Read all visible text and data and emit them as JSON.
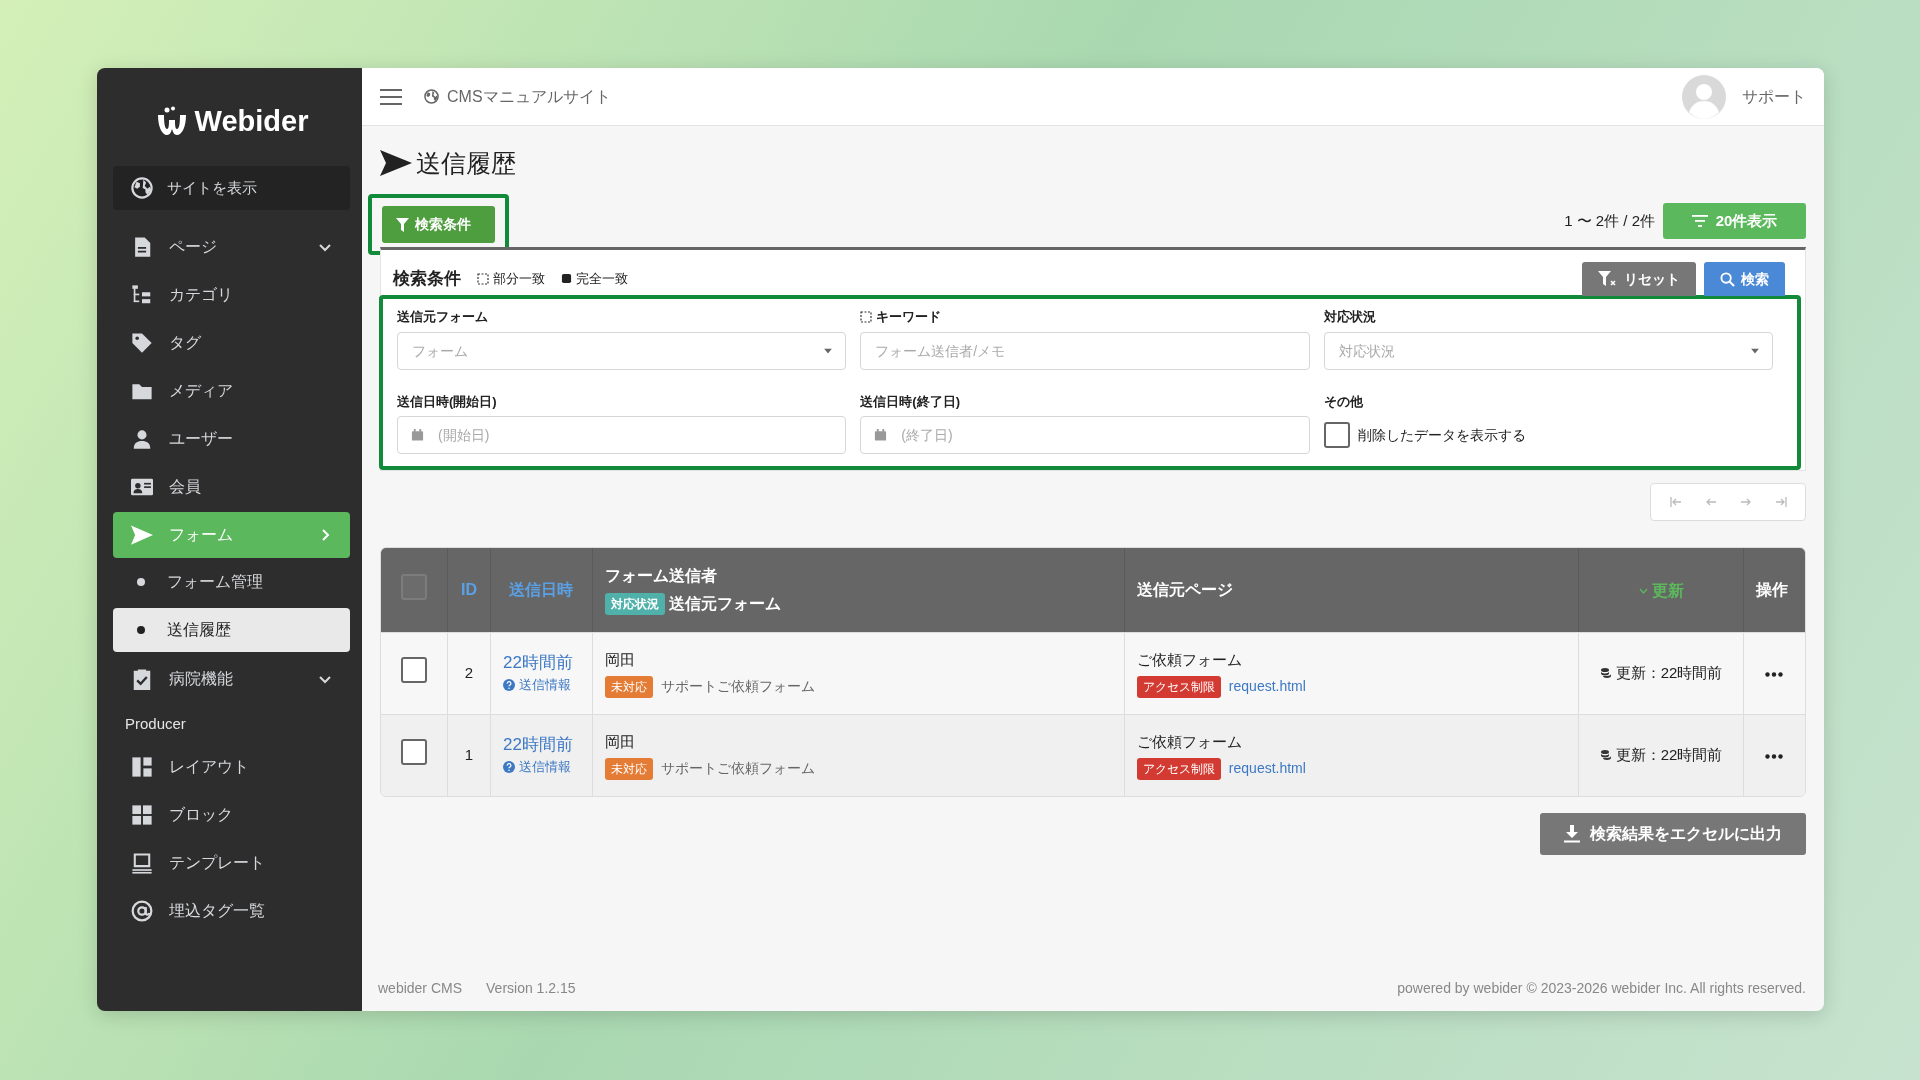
{
  "sidebar": {
    "logo": "Webider",
    "site_link": "サイトを表示",
    "items": [
      {
        "kind": "link",
        "label": "ページ",
        "expanded": false,
        "selected": false
      },
      {
        "kind": "link",
        "label": "カテゴリ",
        "selected": false
      },
      {
        "kind": "link",
        "label": "タグ",
        "selected": false
      },
      {
        "kind": "link",
        "label": "メディア",
        "selected": false
      },
      {
        "kind": "link",
        "label": "ユーザー",
        "selected": false
      },
      {
        "kind": "link",
        "label": "会員",
        "selected": false
      },
      {
        "kind": "link",
        "label": "フォーム",
        "expanded": true,
        "selected": true,
        "children": [
          {
            "label": "フォーム管理",
            "selected": false
          },
          {
            "label": "送信履歴",
            "selected": true
          }
        ]
      },
      {
        "kind": "link",
        "label": "病院機能",
        "expanded": false,
        "selected": false
      },
      {
        "kind": "heading",
        "label": "Producer"
      },
      {
        "kind": "link",
        "label": "レイアウト",
        "selected": false
      },
      {
        "kind": "link",
        "label": "ブロック",
        "selected": false
      },
      {
        "kind": "link",
        "label": "テンプレート",
        "selected": false
      },
      {
        "kind": "link",
        "label": "埋込タグ一覧",
        "selected": false
      }
    ]
  },
  "topbar": {
    "site_name": "CMSマニュアルサイト",
    "user": "サポート"
  },
  "page_title": "送信履歴",
  "filter_toggle": {
    "label": "検索条件",
    "highlighted": true
  },
  "result_count": "1 〜 2件 / 2件",
  "per_page_button": "20件表示",
  "search_panel": {
    "title": "検索条件",
    "legend": [
      {
        "kind": "partial",
        "label": "部分一致"
      },
      {
        "kind": "exact",
        "label": "完全一致"
      }
    ],
    "buttons": [
      {
        "kind": "reset",
        "label": "リセット"
      },
      {
        "kind": "search",
        "label": "検索"
      }
    ],
    "highlighted": true,
    "fields": [
      {
        "kind": "select",
        "label": "送信元フォーム",
        "placeholder": "フォーム"
      },
      {
        "kind": "text",
        "label": "キーワード",
        "placeholder": "フォーム送信者/メモ",
        "partial_match": true
      },
      {
        "kind": "select",
        "label": "対応状況",
        "placeholder": "対応状況"
      },
      {
        "kind": "date",
        "label": "送信日時(開始日)",
        "placeholder": "(開始日)"
      },
      {
        "kind": "date",
        "label": "送信日時(終了日)",
        "placeholder": "(終了日)"
      },
      {
        "kind": "checkbox",
        "label": "その他",
        "option": "削除したデータを表示する",
        "checked": false
      }
    ]
  },
  "pager": {
    "disabled": true
  },
  "table": {
    "select_all": {
      "checked": false
    },
    "columns": [
      {
        "kind": "id",
        "label": "ID",
        "sortable": true
      },
      {
        "kind": "time",
        "label": "送信日時",
        "sortable": true
      },
      {
        "kind": "sender",
        "label": "フォーム送信者",
        "badge": "対応状況",
        "sub_label": "送信元フォーム"
      },
      {
        "kind": "page",
        "label": "送信元ページ"
      },
      {
        "kind": "updated",
        "label": "更新",
        "sortable": true,
        "sorted": true
      },
      {
        "kind": "ops",
        "label": "操作"
      }
    ],
    "rows": [
      {
        "checked": false,
        "id": "2",
        "time": "22時間前",
        "info": "送信情報",
        "sender": "岡田",
        "status": "未対応",
        "form": "サポートご依頼フォーム",
        "page_title": "ご依頼フォーム",
        "access": "アクセス制限",
        "page_link": "request.html",
        "updated": "更新：22時間前"
      },
      {
        "checked": false,
        "id": "1",
        "time": "22時間前",
        "info": "送信情報",
        "sender": "岡田",
        "status": "未対応",
        "form": "サポートご依頼フォーム",
        "page_title": "ご依頼フォーム",
        "access": "アクセス制限",
        "page_link": "request.html",
        "updated": "更新：22時間前"
      }
    ]
  },
  "export_button": "検索結果をエクセルに出力",
  "footer": {
    "product": "webider CMS",
    "version": "Version 1.2.15",
    "copyright": "powered by webider © 2023-2026 webider Inc. All rights reserved."
  }
}
